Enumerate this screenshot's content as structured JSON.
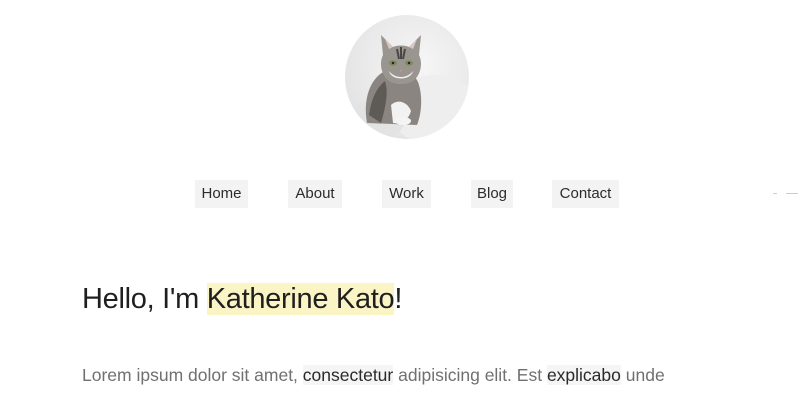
{
  "profile": {
    "avatar_icon": "cat-photo-icon"
  },
  "nav": {
    "items": [
      {
        "label": "Home"
      },
      {
        "label": "About"
      },
      {
        "label": "Work"
      },
      {
        "label": "Blog"
      },
      {
        "label": "Contact"
      }
    ]
  },
  "hero": {
    "greeting_prefix": "Hello, I'm ",
    "name": "Katherine Kato",
    "greeting_suffix": "!"
  },
  "intro": {
    "part1": "Lorem ipsum dolor sit amet, ",
    "code1": "consectetur",
    "part2": " adipisicing elit. Est ",
    "code2": "explicabo",
    "part3": " unde"
  },
  "colors": {
    "name_highlight": "#fbf4c4",
    "nav_background": "#f3f3f3",
    "text_muted": "#707070",
    "text_dark": "#1f1f1f"
  }
}
